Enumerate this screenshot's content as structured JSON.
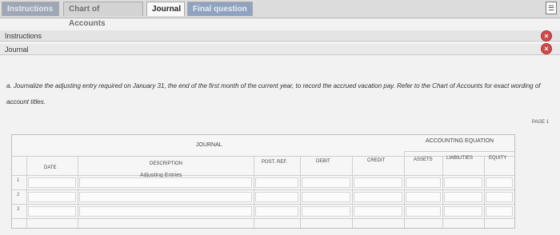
{
  "tabs": {
    "instructions": "Instructions",
    "chart_of_accounts": "Chart of Accounts",
    "journal": "Journal",
    "final_question": "Final question"
  },
  "sections": {
    "instructions": "Instructions",
    "journal": "Journal"
  },
  "question": "a. Journalize the adjusting entry required on January 31, the end of the first month of the current year, to record the accrued vacation pay. Refer to the Chart of Accounts for exact wording of account titles.",
  "journal": {
    "page_label": "PAGE 1",
    "title": "JOURNAL",
    "accounting_equation": "ACCOUNTING EQUATION",
    "columns": {
      "date": "DATE",
      "description": "DESCRIPTION",
      "post_ref": "POST. REF.",
      "debit": "DEBIT",
      "credit": "CREDIT",
      "assets": "ASSETS",
      "liabilities": "LIABILITIES",
      "equity": "EQUITY"
    },
    "first_row_description": "Adjusting Entries",
    "row_numbers": [
      "1",
      "2",
      "3"
    ]
  }
}
